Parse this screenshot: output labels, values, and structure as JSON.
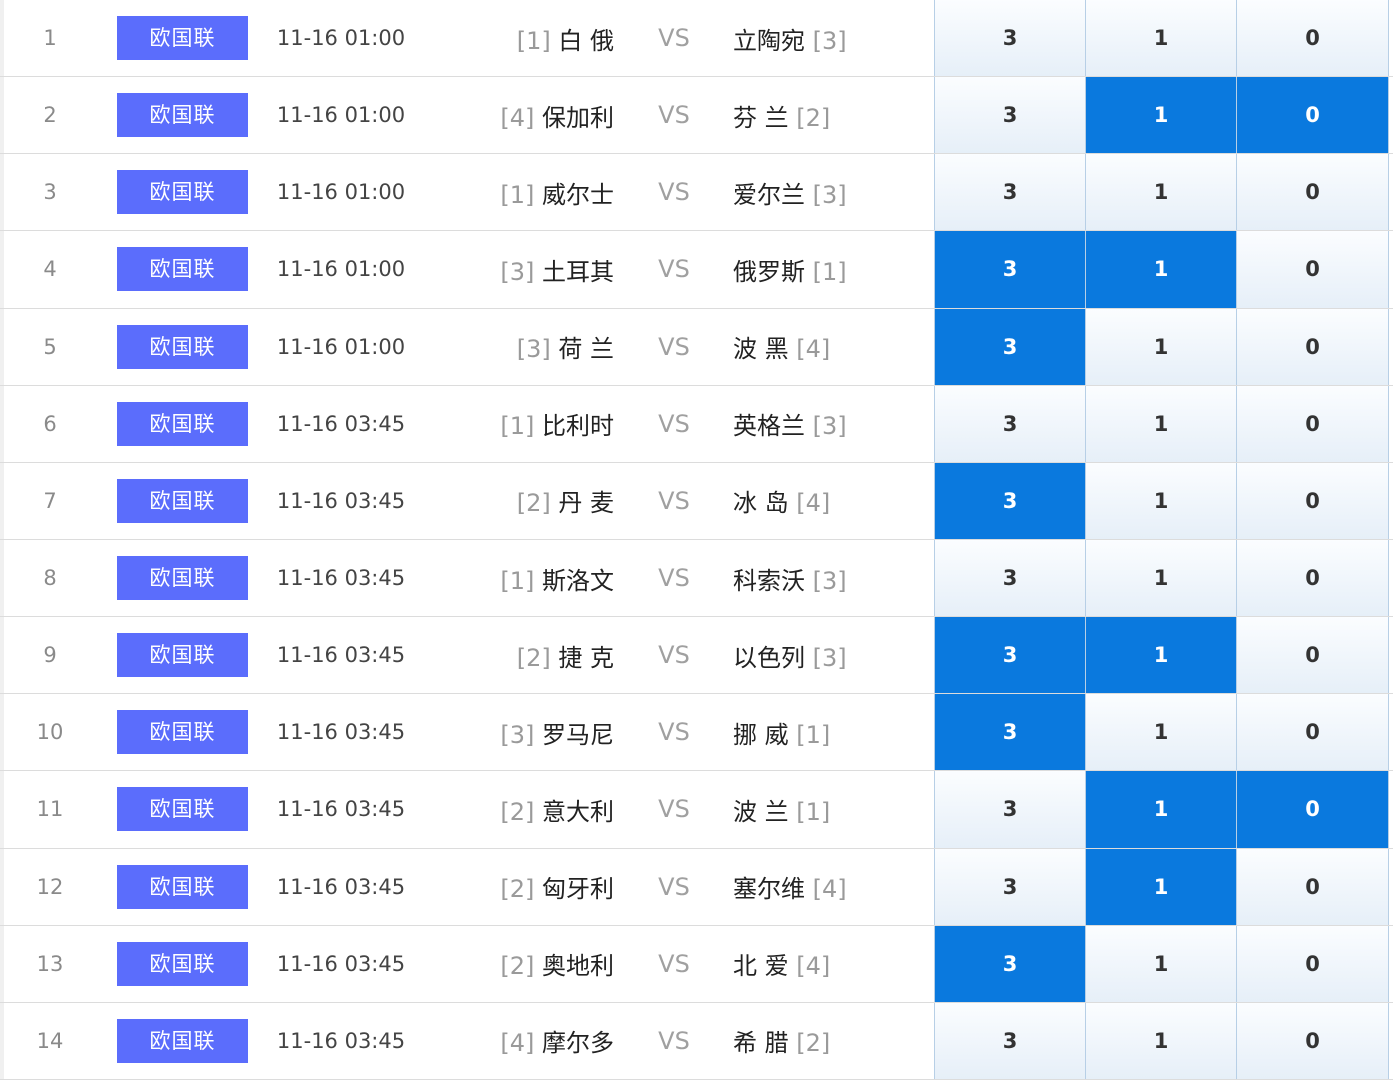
{
  "colors": {
    "league_badge": "#5b6dfc",
    "selected_odds": "#0a79de"
  },
  "vs_label": "VS",
  "rows": [
    {
      "num": "1",
      "league": "欧国联",
      "time": "11-16 01:00",
      "home_rank": "[1]",
      "home": "白 俄",
      "away": "立陶宛",
      "away_rank": "[3]",
      "win": "3",
      "draw": "1",
      "loss": "0",
      "sel": [
        false,
        false,
        false
      ]
    },
    {
      "num": "2",
      "league": "欧国联",
      "time": "11-16 01:00",
      "home_rank": "[4]",
      "home": "保加利",
      "away": "芬 兰",
      "away_rank": "[2]",
      "win": "3",
      "draw": "1",
      "loss": "0",
      "sel": [
        false,
        true,
        true
      ]
    },
    {
      "num": "3",
      "league": "欧国联",
      "time": "11-16 01:00",
      "home_rank": "[1]",
      "home": "威尔士",
      "away": "爱尔兰",
      "away_rank": "[3]",
      "win": "3",
      "draw": "1",
      "loss": "0",
      "sel": [
        false,
        false,
        false
      ]
    },
    {
      "num": "4",
      "league": "欧国联",
      "time": "11-16 01:00",
      "home_rank": "[3]",
      "home": "土耳其",
      "away": "俄罗斯",
      "away_rank": "[1]",
      "win": "3",
      "draw": "1",
      "loss": "0",
      "sel": [
        true,
        true,
        false
      ]
    },
    {
      "num": "5",
      "league": "欧国联",
      "time": "11-16 01:00",
      "home_rank": "[3]",
      "home": "荷 兰",
      "away": "波 黑",
      "away_rank": "[4]",
      "win": "3",
      "draw": "1",
      "loss": "0",
      "sel": [
        true,
        false,
        false
      ]
    },
    {
      "num": "6",
      "league": "欧国联",
      "time": "11-16 03:45",
      "home_rank": "[1]",
      "home": "比利时",
      "away": "英格兰",
      "away_rank": "[3]",
      "win": "3",
      "draw": "1",
      "loss": "0",
      "sel": [
        false,
        false,
        false
      ]
    },
    {
      "num": "7",
      "league": "欧国联",
      "time": "11-16 03:45",
      "home_rank": "[2]",
      "home": "丹 麦",
      "away": "冰 岛",
      "away_rank": "[4]",
      "win": "3",
      "draw": "1",
      "loss": "0",
      "sel": [
        true,
        false,
        false
      ]
    },
    {
      "num": "8",
      "league": "欧国联",
      "time": "11-16 03:45",
      "home_rank": "[1]",
      "home": "斯洛文",
      "away": "科索沃",
      "away_rank": "[3]",
      "win": "3",
      "draw": "1",
      "loss": "0",
      "sel": [
        false,
        false,
        false
      ]
    },
    {
      "num": "9",
      "league": "欧国联",
      "time": "11-16 03:45",
      "home_rank": "[2]",
      "home": "捷 克",
      "away": "以色列",
      "away_rank": "[3]",
      "win": "3",
      "draw": "1",
      "loss": "0",
      "sel": [
        true,
        true,
        false
      ]
    },
    {
      "num": "10",
      "league": "欧国联",
      "time": "11-16 03:45",
      "home_rank": "[3]",
      "home": "罗马尼",
      "away": "挪 威",
      "away_rank": "[1]",
      "win": "3",
      "draw": "1",
      "loss": "0",
      "sel": [
        true,
        false,
        false
      ]
    },
    {
      "num": "11",
      "league": "欧国联",
      "time": "11-16 03:45",
      "home_rank": "[2]",
      "home": "意大利",
      "away": "波 兰",
      "away_rank": "[1]",
      "win": "3",
      "draw": "1",
      "loss": "0",
      "sel": [
        false,
        true,
        true
      ]
    },
    {
      "num": "12",
      "league": "欧国联",
      "time": "11-16 03:45",
      "home_rank": "[2]",
      "home": "匈牙利",
      "away": "塞尔维",
      "away_rank": "[4]",
      "win": "3",
      "draw": "1",
      "loss": "0",
      "sel": [
        false,
        true,
        false
      ]
    },
    {
      "num": "13",
      "league": "欧国联",
      "time": "11-16 03:45",
      "home_rank": "[2]",
      "home": "奥地利",
      "away": "北 爱",
      "away_rank": "[4]",
      "win": "3",
      "draw": "1",
      "loss": "0",
      "sel": [
        true,
        false,
        false
      ]
    },
    {
      "num": "14",
      "league": "欧国联",
      "time": "11-16 03:45",
      "home_rank": "[4]",
      "home": "摩尔多",
      "away": "希 腊",
      "away_rank": "[2]",
      "win": "3",
      "draw": "1",
      "loss": "0",
      "sel": [
        false,
        false,
        false
      ]
    }
  ]
}
